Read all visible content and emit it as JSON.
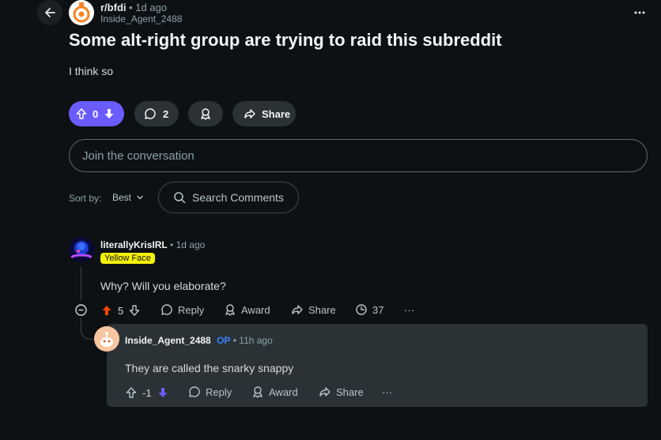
{
  "post": {
    "subreddit": "r/bfdi",
    "time": "1d ago",
    "author": "Inside_Agent_2488",
    "title": "Some alt-right group are trying to raid this subreddit",
    "body": "I think so",
    "votes": "0",
    "comments_count": "2",
    "share_label": "Share"
  },
  "comment_box": {
    "placeholder": "Join the conversation"
  },
  "sort": {
    "label": "Sort by:",
    "value": "Best",
    "search_placeholder": "Search Comments"
  },
  "comments": [
    {
      "author": "literallyKrisIRL",
      "time": "1d ago",
      "flair": "Yellow Face",
      "body": "Why? Will you elaborate?",
      "votes": "5",
      "reply": "Reply",
      "award": "Award",
      "share": "Share",
      "stat": "37",
      "more": "···"
    },
    {
      "author": "Inside_Agent_2488",
      "op": "OP",
      "time": "11h ago",
      "body": "They are called the snarky snappy",
      "votes": "-1",
      "reply": "Reply",
      "award": "Award",
      "share": "Share",
      "more": "···"
    }
  ],
  "colors": {
    "accent": "#6a5cff",
    "upvote": "#ff4500",
    "flair_bg": "#f5f10a",
    "op": "#3b82f6"
  }
}
